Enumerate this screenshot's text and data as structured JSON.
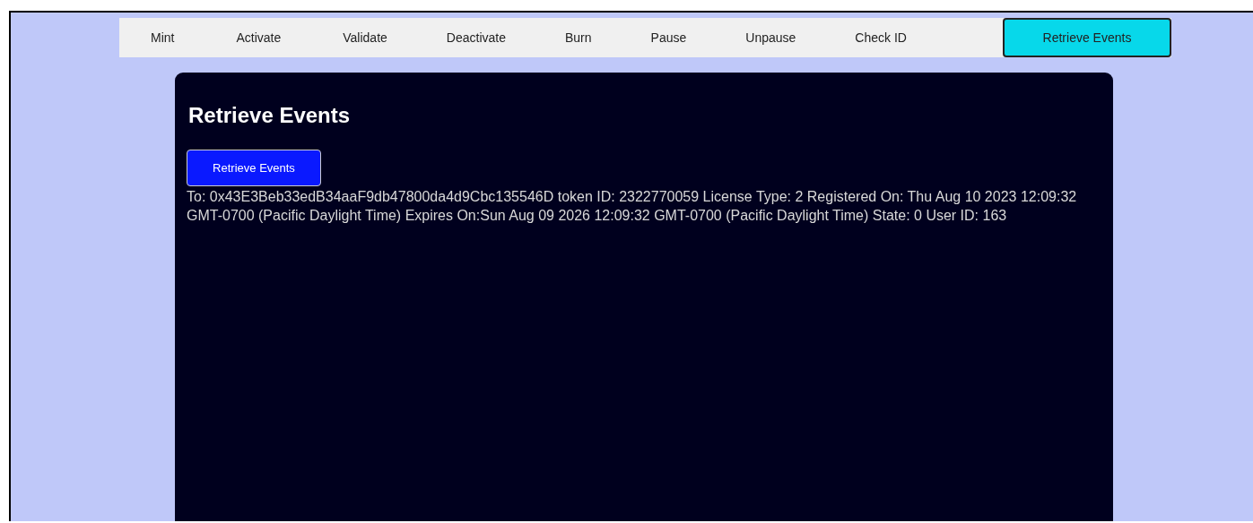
{
  "tabs": [
    {
      "label": "Mint",
      "selected": false
    },
    {
      "label": "Activate",
      "selected": false
    },
    {
      "label": "Validate",
      "selected": false
    },
    {
      "label": "Deactivate",
      "selected": false
    },
    {
      "label": "Burn",
      "selected": false
    },
    {
      "label": "Pause",
      "selected": false
    },
    {
      "label": "Unpause",
      "selected": false
    },
    {
      "label": "Check ID",
      "selected": false
    },
    {
      "label": "Retrieve Events",
      "selected": true
    }
  ],
  "panel": {
    "title": "Retrieve Events",
    "button": "Retrieve Events",
    "result": "To: 0x43E3Beb33edB34aaF9db47800da4d9Cbc135546D token ID: 2322770059 License Type: 2 Registered On: Thu Aug 10 2023 12:09:32 GMT-0700 (Pacific Daylight Time) Expires On:Sun Aug 09 2026 12:09:32 GMT-0700 (Pacific Daylight Time) State: 0 User ID: 163"
  }
}
